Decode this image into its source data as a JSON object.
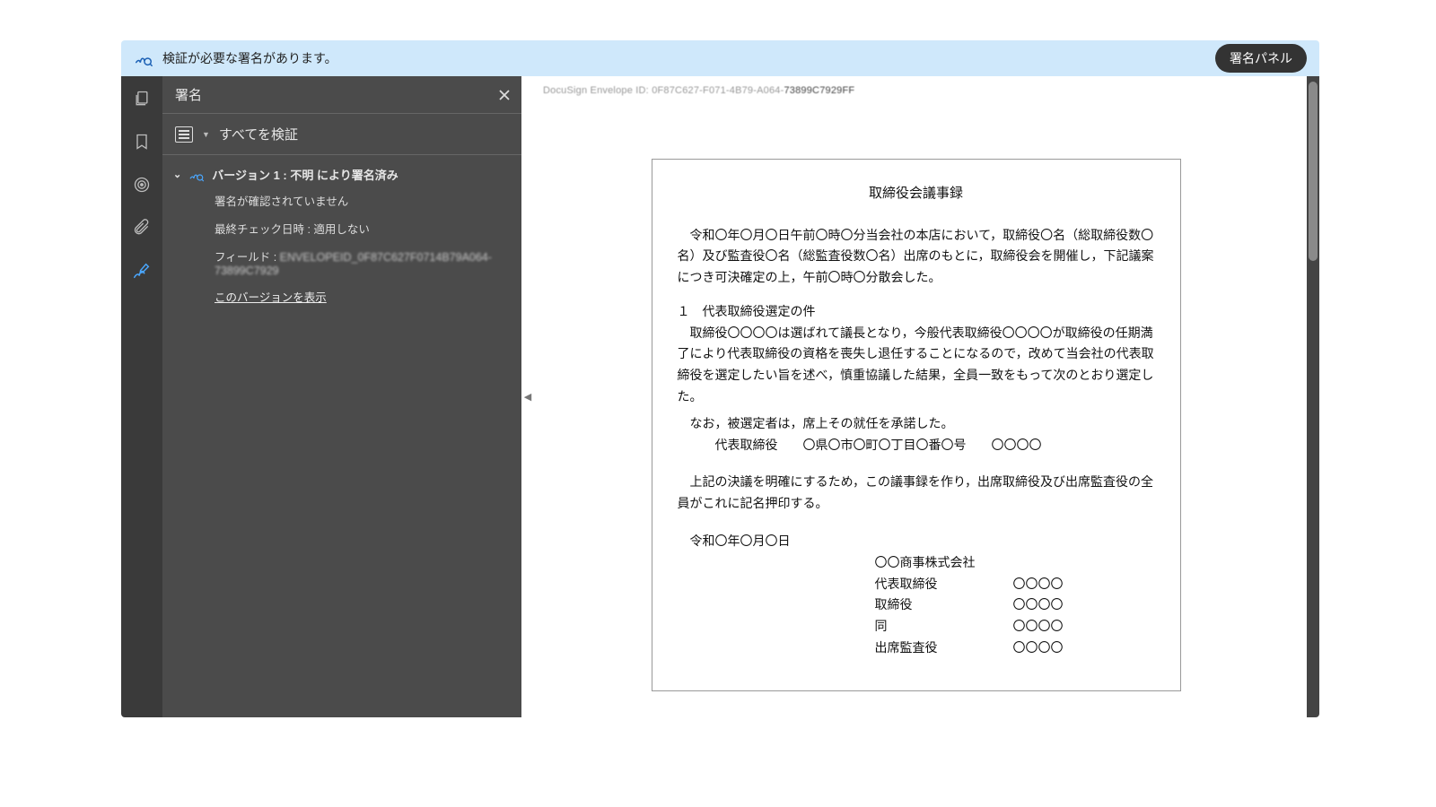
{
  "notify": {
    "message": "検証が必要な署名があります。",
    "button": "署名パネル"
  },
  "sidebar": {
    "title": "署名",
    "verify_all": "すべてを検証",
    "version_head": "バージョン 1 : 不明 により署名済み",
    "detail_unverified": "署名が確認されていません",
    "detail_lastcheck": "最終チェック日時 : 適用しない",
    "detail_field_label": "フィールド : ",
    "detail_field_value": "ENVELOPEID_0F87C627F0714B79A064-73899C7929",
    "show_version": "このバージョンを表示"
  },
  "document": {
    "envelope_prefix": "DocuSign Envelope ID: 0F87C627-F071-4B79-A064-",
    "envelope_suffix": "73899C7929FF",
    "title": "取締役会議事録",
    "para1": "令和〇年〇月〇日午前〇時〇分当会社の本店において，取締役〇名（総取締役数〇名）及び監査役〇名（総監査役数〇名）出席のもとに，取締役会を開催し，下記議案につき可決確定の上，午前〇時〇分散会した。",
    "section_no": "１　代表取締役選定の件",
    "para2": "取締役〇〇〇〇は選ばれて議長となり，今般代表取締役〇〇〇〇が取締役の任期満了により代表取締役の資格を喪失し退任することになるので，改めて当会社の代表取締役を選定したい旨を述べ，慎重協議した結果，全員一致をもって次のとおり選定した。",
    "note": "なお，被選定者は，席上その就任を承諾した。",
    "rep_line": "代表取締役　　〇県〇市〇町〇丁目〇番〇号　　〇〇〇〇",
    "para3": "上記の決議を明確にするため，この議事録を作り，出席取締役及び出席監査役の全員がこれに記名押印する。",
    "date": "令和〇年〇月〇日",
    "company": "〇〇商事株式会社",
    "signatories": [
      {
        "role": "代表取締役",
        "name": "〇〇〇〇"
      },
      {
        "role": "取締役",
        "name": "〇〇〇〇"
      },
      {
        "role": "同",
        "name": "〇〇〇〇"
      },
      {
        "role": "出席監査役",
        "name": "〇〇〇〇"
      }
    ]
  }
}
